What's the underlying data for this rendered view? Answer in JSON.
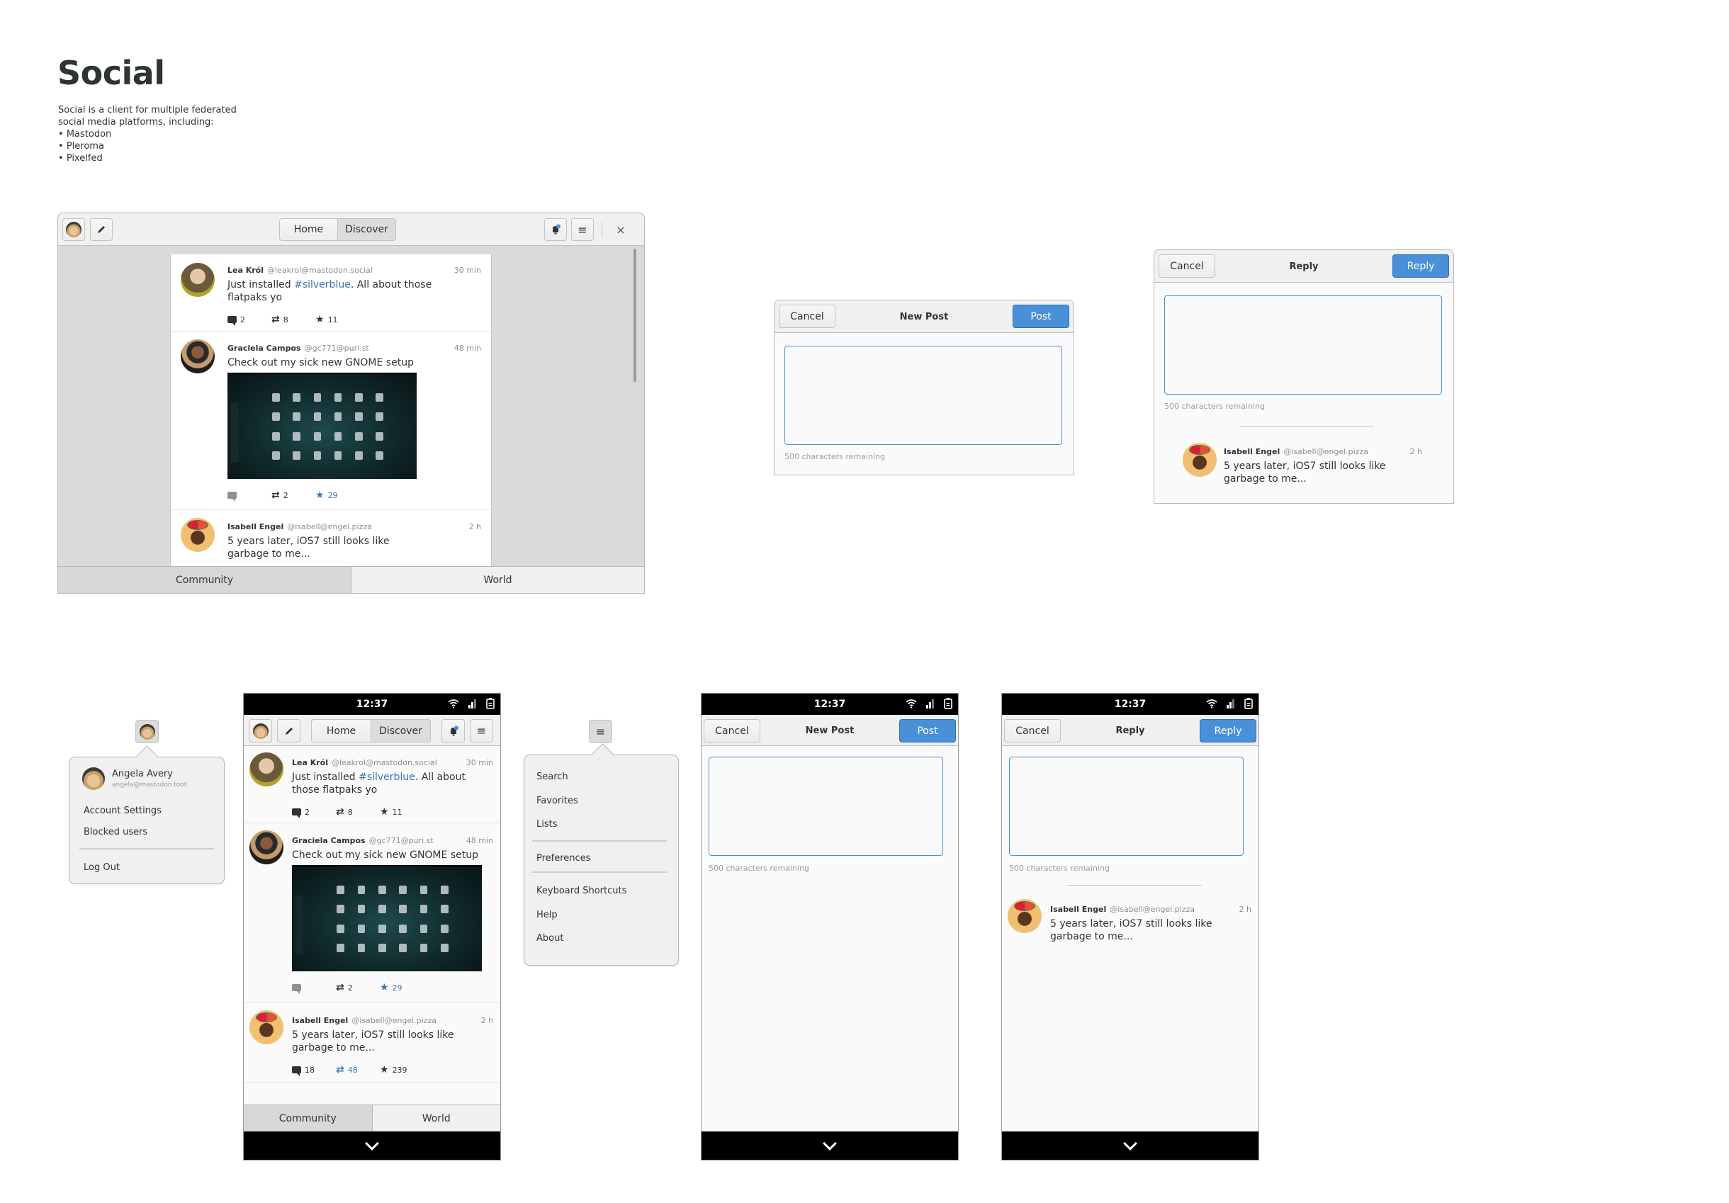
{
  "intro": {
    "title": "Social",
    "description": "Social is a client for multiple federated social media platforms, including:",
    "platforms": [
      "Mastodon",
      "Pleroma",
      "Pixelfed"
    ]
  },
  "header": {
    "tabs": [
      "Home",
      "Discover"
    ],
    "active_tab": "Discover",
    "close_symbol": "×",
    "menu_symbol": "≡"
  },
  "timeline_tabs": {
    "items": [
      "Community",
      "World"
    ],
    "active": "Community"
  },
  "posts": [
    {
      "name": "Lea Król",
      "handle": "@leakrol@mastodon.social",
      "time": "30 min",
      "text_before": "Just installed ",
      "hashtag": "#silverblue",
      "text_after": ". All about those flatpaks yo",
      "replies": "2",
      "boosts": "8",
      "favorites": "11"
    },
    {
      "name": "Graciela Campos",
      "handle": "@gc771@puri.st",
      "time": "48 min",
      "text": "Check out my sick new GNOME setup",
      "has_image": true,
      "replies": "",
      "boosts": "2",
      "favorites": "29",
      "favorited": true
    },
    {
      "name": "Isabell Engel",
      "handle": "@isabell@engel.pizza",
      "time": "2 h",
      "text": "5 years later, iOS7 still looks like garbage to me...",
      "replies": "18",
      "boosts": "48",
      "favorites": "239",
      "boosted": true
    }
  ],
  "new_post_dialog": {
    "cancel_label": "Cancel",
    "title": "New Post",
    "submit_label": "Post",
    "remaining": "500 characters remaining",
    "text_value": ""
  },
  "reply_dialog": {
    "cancel_label": "Cancel",
    "title": "Reply",
    "submit_label": "Reply",
    "remaining": "500 characters remaining",
    "text_value": ""
  },
  "user_menu": {
    "name": "Angela Avery",
    "account": "angela@mastodon.toot",
    "items": [
      "Account Settings",
      "Blocked users"
    ],
    "logout": "Log Out"
  },
  "main_menu": {
    "group1": [
      "Search",
      "Favorites",
      "Lists"
    ],
    "group2": [
      "Preferences"
    ],
    "group3": [
      "Keyboard Shortcuts",
      "Help",
      "About"
    ]
  },
  "status_bar": {
    "time": "12:37"
  },
  "colors": {
    "accent": "#4a90d9",
    "link": "#3a74b8",
    "notification_dot": "#4a90d9"
  }
}
